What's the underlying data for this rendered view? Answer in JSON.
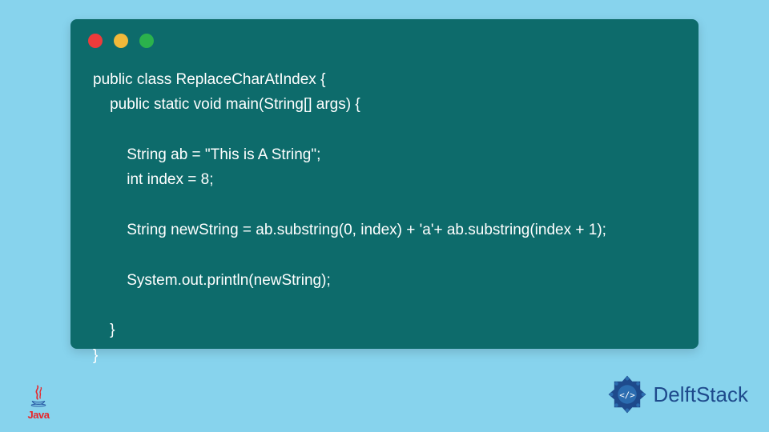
{
  "code": {
    "lines": [
      "public class ReplaceCharAtIndex {",
      "    public static void main(String[] args) {",
      "",
      "        String ab = \"This is A String\";",
      "        int index = 8;",
      "",
      "        String newString = ab.substring(0, index) + 'a'+ ab.substring(index + 1);",
      "",
      "        System.out.println(newString);",
      "",
      "    }",
      "}"
    ]
  },
  "window": {
    "dot_red": "#ed3b3b",
    "dot_yellow": "#f2b93a",
    "dot_green": "#2bb24c",
    "bg": "#0d6b6b"
  },
  "branding": {
    "java_label": "Java",
    "delft_label": "DelftStack"
  },
  "page": {
    "bg": "#87d3ed"
  }
}
